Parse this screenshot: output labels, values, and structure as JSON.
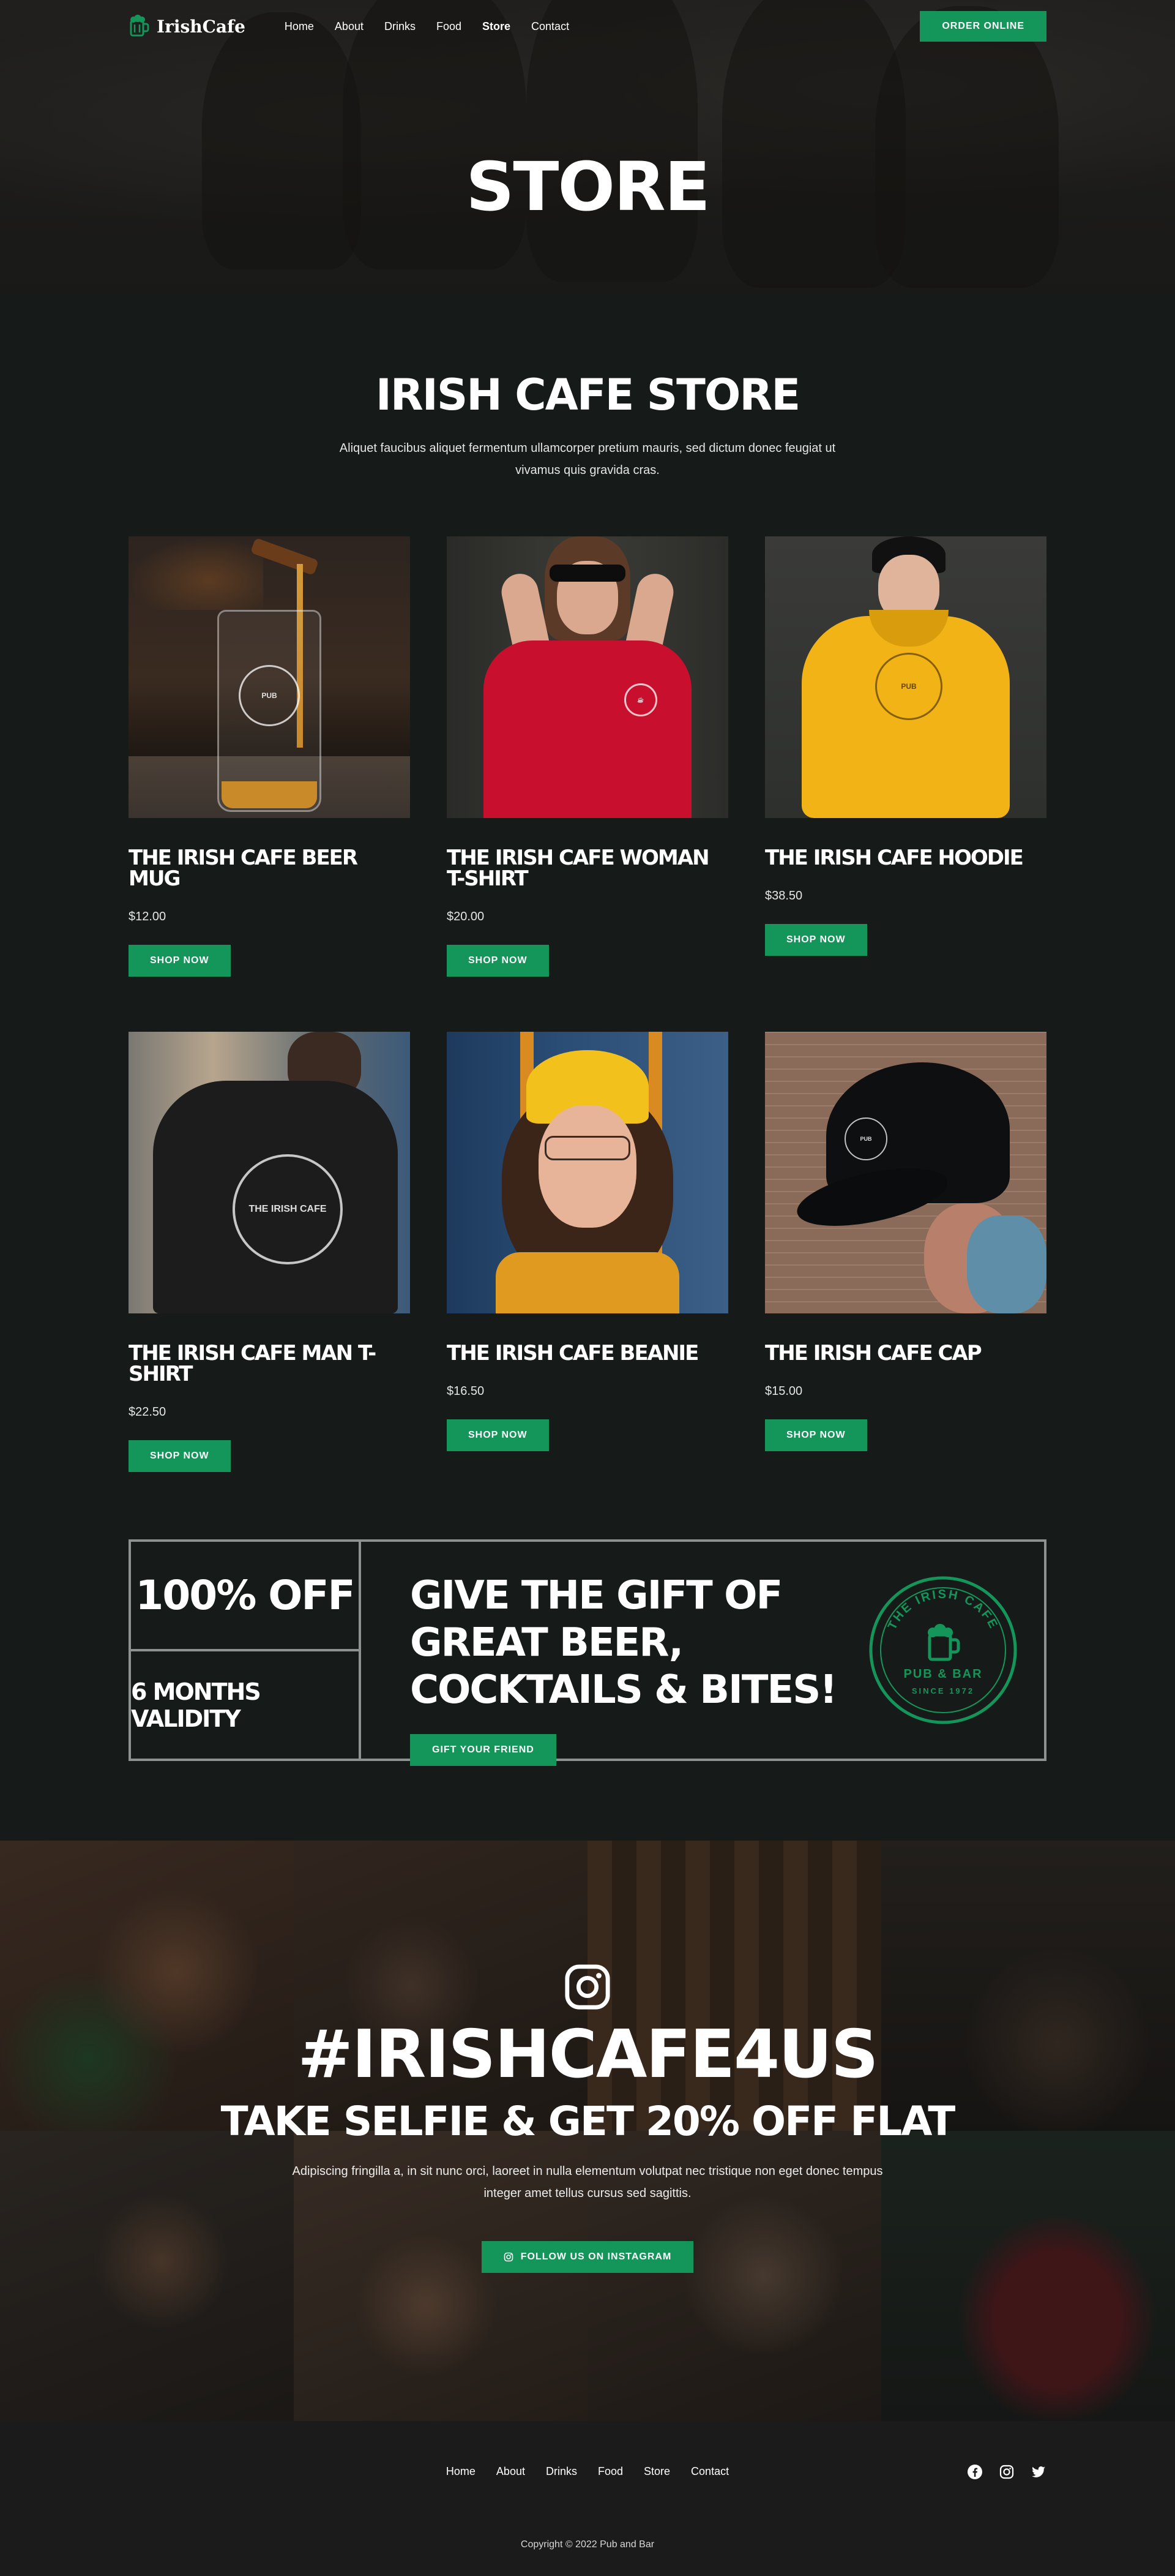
{
  "brand": {
    "name": "IrishCafe",
    "accent": "#14955a"
  },
  "nav": {
    "items": [
      "Home",
      "About",
      "Drinks",
      "Food",
      "Store",
      "Contact"
    ],
    "active": "Store",
    "cta": "ORDER ONLINE"
  },
  "hero": {
    "title": "STORE"
  },
  "store": {
    "title": "IRISH CAFE STORE",
    "description": "Aliquet faucibus aliquet fermentum ullamcorper pretium mauris, sed dictum donec feugiat ut vivamus quis gravida cras.",
    "products": [
      {
        "name": "THE IRISH CAFE BEER MUG",
        "price": "$12.00",
        "button": "SHOP NOW",
        "image": "beer-glass"
      },
      {
        "name": "THE IRISH CAFE WOMAN T-SHIRT",
        "price": "$20.00",
        "button": "SHOP NOW",
        "image": "red-tshirt"
      },
      {
        "name": "THE IRISH CAFE HOODIE",
        "price": "$38.50",
        "button": "SHOP NOW",
        "image": "yellow-hoodie"
      },
      {
        "name": "THE IRISH CAFE MAN T-SHIRT",
        "price": "$22.50",
        "button": "SHOP NOW",
        "image": "black-tshirt"
      },
      {
        "name": "THE IRISH CAFE BEANIE",
        "price": "$16.50",
        "button": "SHOP NOW",
        "image": "yellow-beanie"
      },
      {
        "name": "THE IRISH CAFE CAP",
        "price": "$15.00",
        "button": "SHOP NOW",
        "image": "black-cap"
      }
    ]
  },
  "promo": {
    "discount": "100% OFF",
    "validity": "6 MONTHS VALIDITY",
    "headline": "GIVE THE GIFT OF GREAT BEER, COCKTAILS & BITES!",
    "button": "GIFT YOUR FRIEND",
    "seal_top": "THE IRISH CAFE",
    "seal_bottom": "PUB & BAR",
    "seal_since": "SINCE 1972"
  },
  "instagram": {
    "icon": "instagram-icon",
    "hashtag": "#IRISHCAFE4US",
    "subtitle": "TAKE SELFIE & GET 20% OFF FLAT",
    "description": "Adipiscing fringilla a, in sit nunc orci, laoreet in nulla elementum volutpat nec tristique non eget donec tempus integer amet tellus cursus sed sagittis.",
    "button": "FOLLOW US ON INSTAGRAM"
  },
  "footer": {
    "links": [
      "Home",
      "About",
      "Drinks",
      "Food",
      "Store",
      "Contact"
    ],
    "socials": [
      "facebook-icon",
      "instagram-icon",
      "twitter-icon"
    ],
    "copyright": "Copyright © 2022 Pub and Bar"
  }
}
